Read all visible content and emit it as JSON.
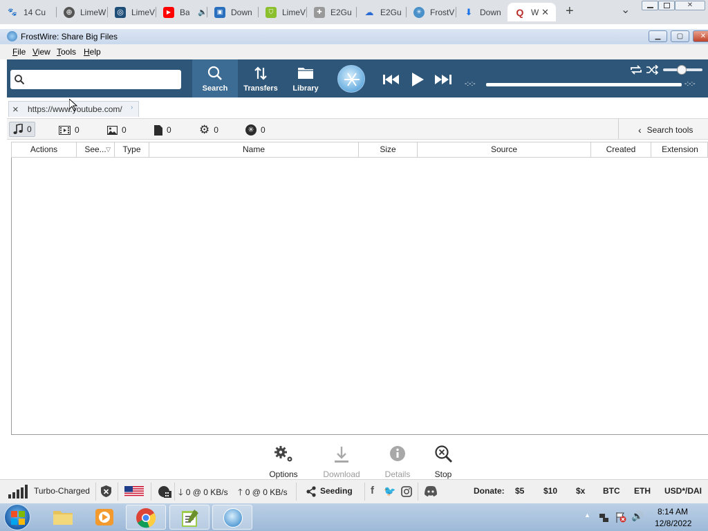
{
  "browser": {
    "tabs": [
      {
        "label": "14 Cu",
        "icon": "paw-icon",
        "color": "#c0392b"
      },
      {
        "label": "LimeW",
        "icon": "globe-icon",
        "color": "#555555"
      },
      {
        "label": "LimeV",
        "icon": "limewire-logo-icon",
        "color": "#1f4e79"
      },
      {
        "label": "Ba",
        "icon": "youtube-icon",
        "color": "#ff0000",
        "audio": true
      },
      {
        "label": "Down",
        "icon": "windows-app-icon",
        "color": "#2a6fbe"
      },
      {
        "label": "LimeV",
        "icon": "shield-icon",
        "color": "#8bbf2e"
      },
      {
        "label": "E2Gu",
        "icon": "puzzle-icon",
        "color": "#888888"
      },
      {
        "label": "E2Gu",
        "icon": "cloud-icon",
        "color": "#2b6cd4"
      },
      {
        "label": "FrostV",
        "icon": "frostwire-icon",
        "color": "#4a90c9"
      },
      {
        "label": "Down",
        "icon": "download-icon",
        "color": "#1a73e8"
      },
      {
        "label": "W",
        "icon": "quora-icon",
        "color": "#b92b27",
        "active": true
      }
    ],
    "new_tab_symbol": "+",
    "tab_menu_symbol": "⌄"
  },
  "window": {
    "title": "FrostWire: Share Big Files",
    "controls": {
      "minimize": "▁",
      "maximize": "▢",
      "close": "✕"
    }
  },
  "menu": [
    {
      "label": "File",
      "mnemonic": "F",
      "rest": "ile"
    },
    {
      "label": "View",
      "mnemonic": "V",
      "rest": "iew"
    },
    {
      "label": "Tools",
      "mnemonic": "T",
      "rest": "ools"
    },
    {
      "label": "Help",
      "mnemonic": "H",
      "rest": "elp"
    }
  ],
  "toolbar": {
    "search_value": "",
    "buttons": [
      {
        "label": "Search",
        "icon": "search-icon",
        "active": true
      },
      {
        "label": "Transfers",
        "icon": "transfers-icon"
      },
      {
        "label": "Library",
        "icon": "folder-icon"
      }
    ],
    "time_elapsed": "-:-:-",
    "time_total": "-:-:-"
  },
  "search_tab": {
    "url": "https://www.youtube.com/",
    "close_symbol": "×"
  },
  "filters": [
    {
      "name": "audio",
      "icon": "music-note-icon",
      "count": "0",
      "active": true
    },
    {
      "name": "video",
      "icon": "film-icon",
      "count": "0"
    },
    {
      "name": "images",
      "icon": "image-icon",
      "count": "0"
    },
    {
      "name": "documents",
      "icon": "document-icon",
      "count": "0"
    },
    {
      "name": "programs",
      "icon": "gear-icon",
      "count": "0"
    },
    {
      "name": "torrents",
      "icon": "frostwire-icon",
      "count": "0"
    }
  ],
  "search_tools_label": "Search tools",
  "columns": [
    "Actions",
    "See...",
    "Type",
    "Name",
    "Size",
    "Source",
    "Created",
    "Extension"
  ],
  "actions": [
    {
      "label": "Options",
      "icon": "options-gears-icon",
      "enabled": true
    },
    {
      "label": "Download",
      "icon": "download-icon",
      "enabled": false
    },
    {
      "label": "Details",
      "icon": "info-icon",
      "enabled": false
    },
    {
      "label": "Stop",
      "icon": "stop-search-icon",
      "enabled": true
    }
  ],
  "status": {
    "connection": "Turbo-Charged",
    "down": "0 @ 0 KB/s",
    "up": "0 @ 0 KB/s",
    "seeding": "Seeding",
    "donate_label": "Donate:",
    "donate_options": [
      "$5",
      "$10",
      "$x",
      "BTC",
      "ETH",
      "USD*/DAI"
    ]
  },
  "taskbar": {
    "time": "8:14 AM",
    "date": "12/8/2022"
  }
}
